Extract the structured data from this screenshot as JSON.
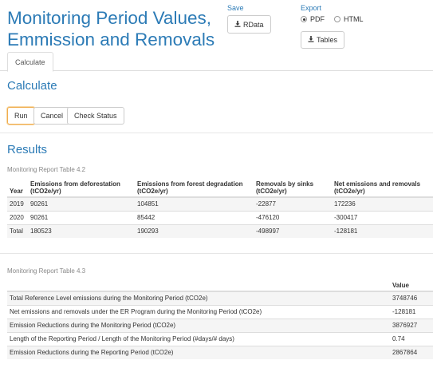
{
  "title_line1": "Monitoring Period Values,",
  "title_line2": "Emmission and Removals",
  "save": {
    "label": "Save",
    "rdata_button": "RData",
    "icon": "download-icon"
  },
  "export": {
    "label": "Export",
    "options": [
      "PDF",
      "HTML"
    ],
    "selected": "PDF",
    "tables_button": "Tables"
  },
  "tabs": [
    {
      "label": "Calculate",
      "active": true
    }
  ],
  "calculate": {
    "heading": "Calculate",
    "buttons": {
      "run": "Run",
      "cancel": "Cancel",
      "check_status": "Check Status"
    }
  },
  "results": {
    "heading": "Results",
    "table1": {
      "caption": "Monitoring Report Table 4.2",
      "headers": [
        "Year",
        "Emissions from deforestation (tCO2e/yr)",
        "Emissions from forest degradation (tCO2e/yr)",
        "Removals by sinks (tCO2e/yr)",
        "Net emissions and removals (tCO2e/yr)"
      ],
      "rows": [
        [
          "2019",
          "90261",
          "104851",
          "-22877",
          "172236"
        ],
        [
          "2020",
          "90261",
          "85442",
          "-476120",
          "-300417"
        ],
        [
          "Total",
          "180523",
          "190293",
          "-498997",
          "-128181"
        ]
      ]
    },
    "table2": {
      "caption": "Monitoring Report Table 4.3",
      "headers": [
        "",
        "Value"
      ],
      "rows": [
        [
          "Total Reference Level emissions during the Monitoring Period (tCO2e)",
          "3748746"
        ],
        [
          "Net emissions and removals under the ER Program during the Monitoring Period (tCO2e)",
          "-128181"
        ],
        [
          "Emission Reductions during the Monitoring Period (tCO2e)",
          "3876927"
        ],
        [
          "Length of the Reporting Period / Length of the Monitoring Period (#days/# days)",
          "0.74"
        ],
        [
          "Emission Reductions during the Reporting Period (tCO2e)",
          "2867864"
        ]
      ]
    }
  },
  "colors": {
    "accent": "#2c7bb6",
    "run_border": "#f0ad4e"
  }
}
